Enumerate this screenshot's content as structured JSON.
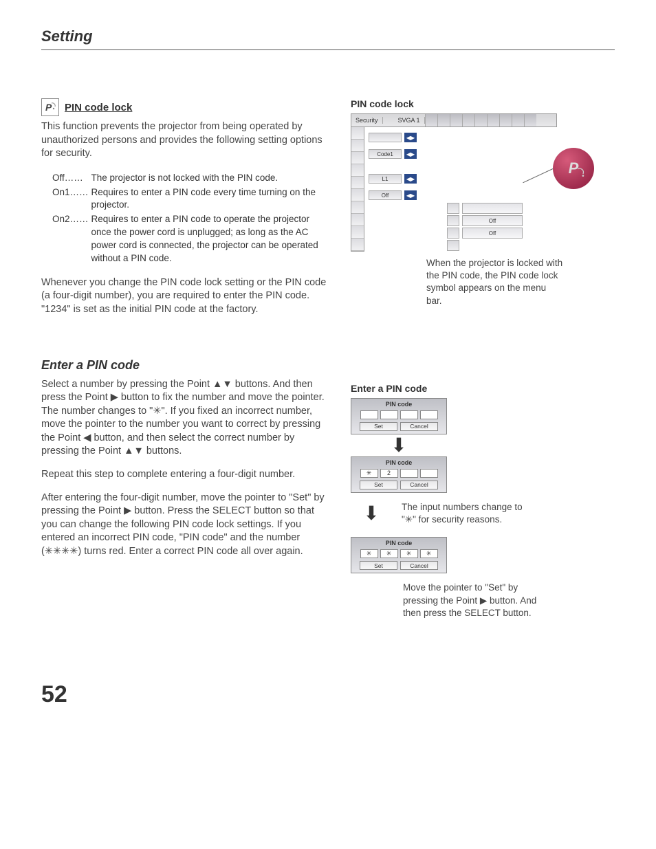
{
  "header": {
    "title": "Setting"
  },
  "pageNumber": "52",
  "pin_section": {
    "title": "PIN code lock",
    "intro": "This function prevents the projector from being operated by unauthorized persons and provides the following setting options for security.",
    "options": {
      "off_key": "Off……",
      "off_val": "The projector is not locked with the PIN code.",
      "on1_key": "On1……",
      "on1_val": "Requires to enter a PIN code every time turning on the projector.",
      "on2_key": "On2……",
      "on2_val": "Requires to enter a PIN code to operate the projector once the power cord is unplugged; as long as the AC power cord is connected, the projector can be operated without a PIN code."
    },
    "para2": "Whenever you change the PIN code lock setting or the PIN code (a four-digit number), you are required to enter the PIN code. \"1234\" is set as the initial PIN code at the factory."
  },
  "enter_section": {
    "title": "Enter a PIN code",
    "para1": "Select a number by pressing the Point ▲▼ buttons. And then press the Point ▶ button to fix the number and move the pointer. The number changes to \"✳\".  If you fixed an incorrect number, move the pointer to the number you want to correct by pressing the Point ◀ button, and then select the correct number by pressing the Point ▲▼ buttons.",
    "para2": "Repeat this step to complete entering a four-digit number.",
    "para3": "After entering the four-digit number, move the pointer to \"Set\" by pressing the Point ▶ button.  Press the SELECT button so that you can change the following PIN code lock settings.  If you entered an incorrect PIN code, \"PIN code\" and the number (✳✳✳✳) turns red. Enter a correct PIN code all over again."
  },
  "mock_menu": {
    "title": "PIN code lock",
    "menubar_label": "Security",
    "menubar_mode": "SVGA 1",
    "rows": {
      "r1": "",
      "r2": "Code1",
      "r3": "L1",
      "r4": "Off"
    },
    "popup": {
      "v1": "",
      "v2": "Off",
      "v3": "Off"
    },
    "badge": "P",
    "caption": "When the projector is locked with the PIN code, the PIN code lock symbol appears on the menu bar."
  },
  "pin_figs": {
    "title": "Enter a PIN code",
    "box_title": "PIN code",
    "set": "Set",
    "cancel": "Cancel",
    "box2_cell1": "✳",
    "box2_cell2": "2",
    "box3_star": "✳",
    "cap2": "The input numbers change to \"✳\" for security reasons.",
    "cap3": "Move the pointer to \"Set\" by pressing the Point ▶ button. And then press the SELECT button."
  }
}
